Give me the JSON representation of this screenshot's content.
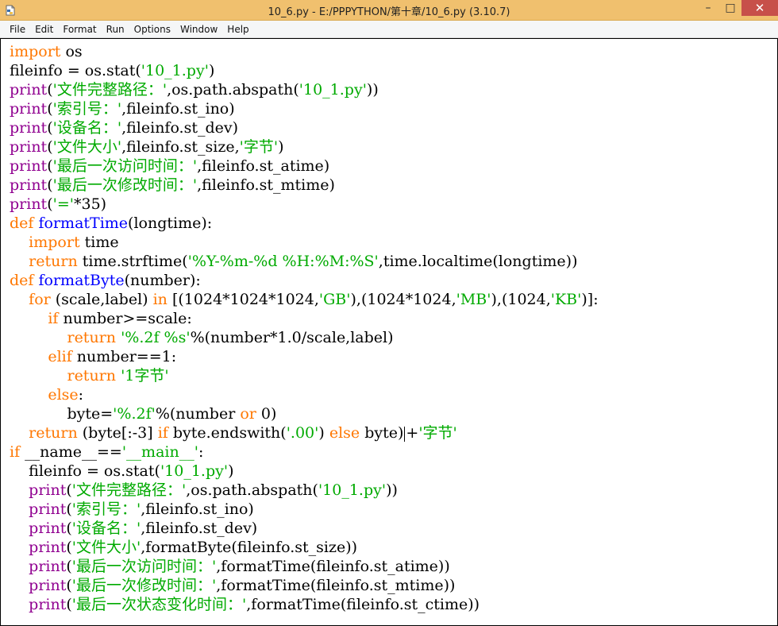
{
  "window": {
    "title": "10_6.py - E:/PPPYTHON/第十章/10_6.py (3.10.7)",
    "minimize_label": "–",
    "maximize_label": "□",
    "close_label": "✕"
  },
  "colors": {
    "keyword": "#ff7700",
    "builtin": "#900090",
    "string": "#00aa00",
    "definition": "#0000ff",
    "titlebar": "#f0c06e"
  },
  "icons": {
    "app": "python-file-icon"
  },
  "menu": [
    "File",
    "Edit",
    "Format",
    "Run",
    "Options",
    "Window",
    "Help"
  ],
  "code_lines": [
    [
      {
        "t": "import",
        "c": "kw"
      },
      {
        "t": " os"
      }
    ],
    [
      {
        "t": "fileinfo = os.stat("
      },
      {
        "t": "'10_1.py'",
        "c": "st"
      },
      {
        "t": ")"
      }
    ],
    [
      {
        "t": "print",
        "c": "bi"
      },
      {
        "t": "("
      },
      {
        "t": "'文件完整路径：'",
        "c": "st"
      },
      {
        "t": ",os.path.abspath("
      },
      {
        "t": "'10_1.py'",
        "c": "st"
      },
      {
        "t": "))"
      }
    ],
    [
      {
        "t": "print",
        "c": "bi"
      },
      {
        "t": "("
      },
      {
        "t": "'索引号：'",
        "c": "st"
      },
      {
        "t": ",fileinfo.st_ino)"
      }
    ],
    [
      {
        "t": "print",
        "c": "bi"
      },
      {
        "t": "("
      },
      {
        "t": "'设备名：'",
        "c": "st"
      },
      {
        "t": ",fileinfo.st_dev)"
      }
    ],
    [
      {
        "t": "print",
        "c": "bi"
      },
      {
        "t": "("
      },
      {
        "t": "'文件大小'",
        "c": "st"
      },
      {
        "t": ",fileinfo.st_size,"
      },
      {
        "t": "'字节'",
        "c": "st"
      },
      {
        "t": ")"
      }
    ],
    [
      {
        "t": "print",
        "c": "bi"
      },
      {
        "t": "("
      },
      {
        "t": "'最后一次访问时间：'",
        "c": "st"
      },
      {
        "t": ",fileinfo.st_atime)"
      }
    ],
    [
      {
        "t": "print",
        "c": "bi"
      },
      {
        "t": "("
      },
      {
        "t": "'最后一次修改时间：'",
        "c": "st"
      },
      {
        "t": ",fileinfo.st_mtime)"
      }
    ],
    [
      {
        "t": "print",
        "c": "bi"
      },
      {
        "t": "("
      },
      {
        "t": "'='",
        "c": "st"
      },
      {
        "t": "*35)"
      }
    ],
    [
      {
        "t": "def",
        "c": "kw"
      },
      {
        "t": " "
      },
      {
        "t": "formatTime",
        "c": "df"
      },
      {
        "t": "(longtime):"
      }
    ],
    [
      {
        "t": "    "
      },
      {
        "t": "import",
        "c": "kw"
      },
      {
        "t": " time"
      }
    ],
    [
      {
        "t": "    "
      },
      {
        "t": "return",
        "c": "kw"
      },
      {
        "t": " time.strftime("
      },
      {
        "t": "'%Y-%m-%d %H:%M:%S'",
        "c": "st"
      },
      {
        "t": ",time.localtime(longtime))"
      }
    ],
    [
      {
        "t": "def",
        "c": "kw"
      },
      {
        "t": " "
      },
      {
        "t": "formatByte",
        "c": "df"
      },
      {
        "t": "(number):"
      }
    ],
    [
      {
        "t": "    "
      },
      {
        "t": "for",
        "c": "kw"
      },
      {
        "t": " (scale,label) "
      },
      {
        "t": "in",
        "c": "kw"
      },
      {
        "t": " [(1024*1024*1024,"
      },
      {
        "t": "'GB'",
        "c": "st"
      },
      {
        "t": "),(1024*1024,"
      },
      {
        "t": "'MB'",
        "c": "st"
      },
      {
        "t": "),(1024,"
      },
      {
        "t": "'KB'",
        "c": "st"
      },
      {
        "t": ")]:"
      }
    ],
    [
      {
        "t": "        "
      },
      {
        "t": "if",
        "c": "kw"
      },
      {
        "t": " number>=scale:"
      }
    ],
    [
      {
        "t": "            "
      },
      {
        "t": "return",
        "c": "kw"
      },
      {
        "t": " "
      },
      {
        "t": "'%.2f %s'",
        "c": "st"
      },
      {
        "t": "%(number*1.0/scale,label)"
      }
    ],
    [
      {
        "t": "        "
      },
      {
        "t": "elif",
        "c": "kw"
      },
      {
        "t": " number==1:"
      }
    ],
    [
      {
        "t": "            "
      },
      {
        "t": "return",
        "c": "kw"
      },
      {
        "t": " "
      },
      {
        "t": "'1字节'",
        "c": "st"
      }
    ],
    [
      {
        "t": "        "
      },
      {
        "t": "else",
        "c": "kw"
      },
      {
        "t": ":"
      }
    ],
    [
      {
        "t": "            byte="
      },
      {
        "t": "'%.2f'",
        "c": "st"
      },
      {
        "t": "%(number "
      },
      {
        "t": "or",
        "c": "kw"
      },
      {
        "t": " 0)"
      }
    ],
    [
      {
        "t": "    "
      },
      {
        "t": "return",
        "c": "kw"
      },
      {
        "t": " (byte[:-3] "
      },
      {
        "t": "if",
        "c": "kw"
      },
      {
        "t": " byte.endswith("
      },
      {
        "t": "'.00'",
        "c": "st"
      },
      {
        "t": ") "
      },
      {
        "t": "else",
        "c": "kw"
      },
      {
        "t": " byte)"
      },
      {
        "cursor": true
      },
      {
        "t": "+"
      },
      {
        "t": "'字节'",
        "c": "st"
      }
    ],
    [
      {
        "t": "if",
        "c": "kw"
      },
      {
        "t": " __name__=="
      },
      {
        "t": "'__main__'",
        "c": "st"
      },
      {
        "t": ":"
      }
    ],
    [
      {
        "t": "    fileinfo = os.stat("
      },
      {
        "t": "'10_1.py'",
        "c": "st"
      },
      {
        "t": ")"
      }
    ],
    [
      {
        "t": "    "
      },
      {
        "t": "print",
        "c": "bi"
      },
      {
        "t": "("
      },
      {
        "t": "'文件完整路径：'",
        "c": "st"
      },
      {
        "t": ",os.path.abspath("
      },
      {
        "t": "'10_1.py'",
        "c": "st"
      },
      {
        "t": "))"
      }
    ],
    [
      {
        "t": "    "
      },
      {
        "t": "print",
        "c": "bi"
      },
      {
        "t": "("
      },
      {
        "t": "'索引号：'",
        "c": "st"
      },
      {
        "t": ",fileinfo.st_ino)"
      }
    ],
    [
      {
        "t": "    "
      },
      {
        "t": "print",
        "c": "bi"
      },
      {
        "t": "("
      },
      {
        "t": "'设备名：'",
        "c": "st"
      },
      {
        "t": ",fileinfo.st_dev)"
      }
    ],
    [
      {
        "t": "    "
      },
      {
        "t": "print",
        "c": "bi"
      },
      {
        "t": "("
      },
      {
        "t": "'文件大小'",
        "c": "st"
      },
      {
        "t": ",formatByte(fileinfo.st_size))"
      }
    ],
    [
      {
        "t": "    "
      },
      {
        "t": "print",
        "c": "bi"
      },
      {
        "t": "("
      },
      {
        "t": "'最后一次访问时间：'",
        "c": "st"
      },
      {
        "t": ",formatTime(fileinfo.st_atime))"
      }
    ],
    [
      {
        "t": "    "
      },
      {
        "t": "print",
        "c": "bi"
      },
      {
        "t": "("
      },
      {
        "t": "'最后一次修改时间：'",
        "c": "st"
      },
      {
        "t": ",formatTime(fileinfo.st_mtime))"
      }
    ],
    [
      {
        "t": "    "
      },
      {
        "t": "print",
        "c": "bi"
      },
      {
        "t": "("
      },
      {
        "t": "'最后一次状态变化时间：'",
        "c": "st"
      },
      {
        "t": ",formatTime(fileinfo.st_ctime))"
      }
    ]
  ]
}
